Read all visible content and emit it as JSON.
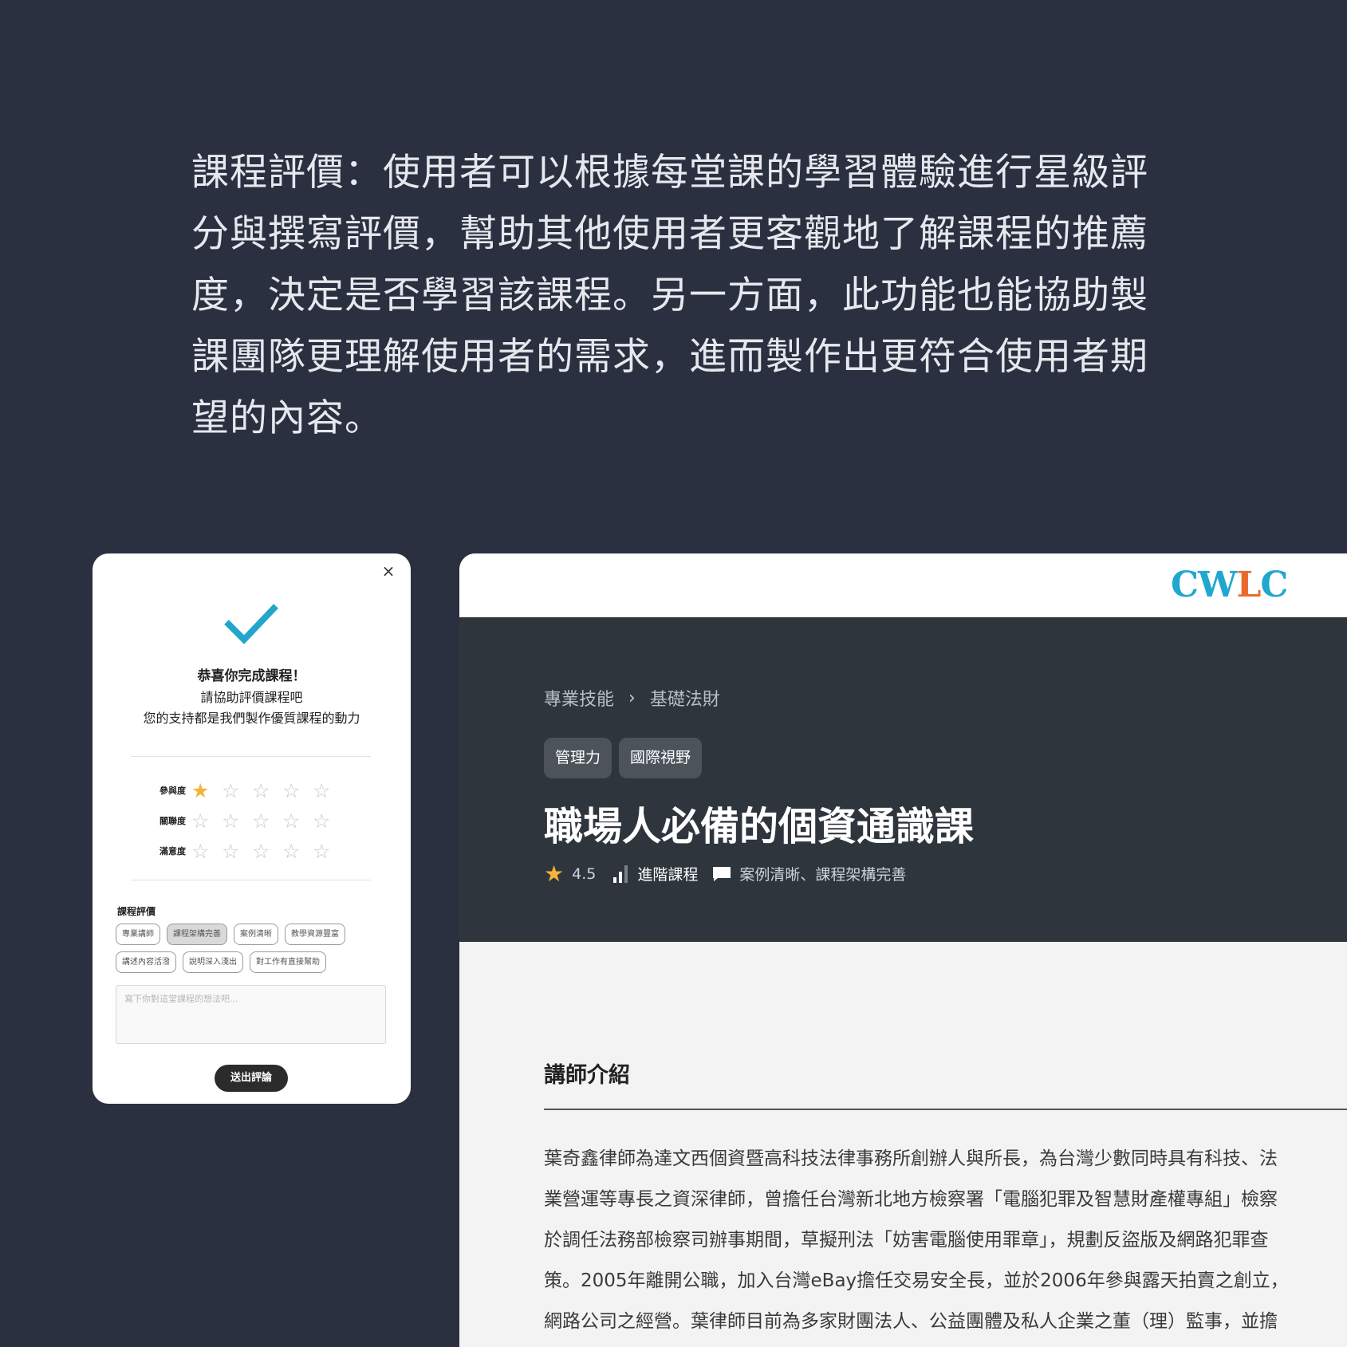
{
  "intro": {
    "text": "課程評價：使用者可以根據每堂課的學習體驗進行星級評分與撰寫評價，幫助其他使用者更客觀地了解課程的推薦度，決定是否學習該課程。另一方面，此功能也能協助製課團隊更理解使用者的需求，進而製作出更符合使用者期望的內容。"
  },
  "modal": {
    "close_icon": "×",
    "title": "恭喜你完成課程！",
    "line1": "請協助評價課程吧",
    "line2": "您的支持都是我們製作優質課程的動力",
    "ratings": [
      {
        "label": "參與度",
        "value": 1,
        "max": 5
      },
      {
        "label": "關聯度",
        "value": 0,
        "max": 5
      },
      {
        "label": "滿意度",
        "value": 0,
        "max": 5
      }
    ],
    "review_label": "課程評價",
    "tags": [
      {
        "label": "專業講師",
        "selected": false
      },
      {
        "label": "課程架構完善",
        "selected": true
      },
      {
        "label": "案例清晰",
        "selected": false
      },
      {
        "label": "教學資源豐富",
        "selected": false
      },
      {
        "label": "講述內容活潑",
        "selected": false
      },
      {
        "label": "說明深入淺出",
        "selected": false
      },
      {
        "label": "對工作有直接幫助",
        "selected": false
      }
    ],
    "textarea_placeholder": "寫下你對這堂課程的想法吧...",
    "submit_label": "送出評論"
  },
  "page": {
    "logo": {
      "c1": "C",
      "w": "W",
      "l": "L",
      "c2": "C"
    },
    "breadcrumb": [
      "專業技能",
      "基礎法財"
    ],
    "breadcrumb_sep": "›",
    "chips": [
      "管理力",
      "國際視野"
    ],
    "course_title": "職場人必備的個資通識課",
    "rating": "4.5",
    "level": "進階課程",
    "review_tags": "案例清晰、課程架構完善",
    "section_title": "講師介紹",
    "bio_lines": [
      "葉奇鑫律師為達文西個資暨高科技法律事務所創辦人與所長，為台灣少數同時具有科技、法",
      "業營運等專長之資深律師，曾擔任台灣新北地方檢察署「電腦犯罪及智慧財產權專組」檢察",
      "於調任法務部檢察司辦事期間，草擬刑法「妨害電腦使用罪章」，規劃反盜版及網路犯罪查",
      "策。2005年離開公職，加入台灣eBay擔任交易安全長，並於2006年參與露天拍賣之創立，",
      "網路公司之經營。葉律師目前為多家財團法人、公益團體及私人企業之董（理）監事，並擔"
    ]
  },
  "colors": {
    "background": "#2b3040",
    "hero": "#2e353d",
    "accent_check": "#22a6cc",
    "star_on": "#f5b33a",
    "logo_blue": "#1fa7cf",
    "logo_orange": "#e96b2c"
  }
}
